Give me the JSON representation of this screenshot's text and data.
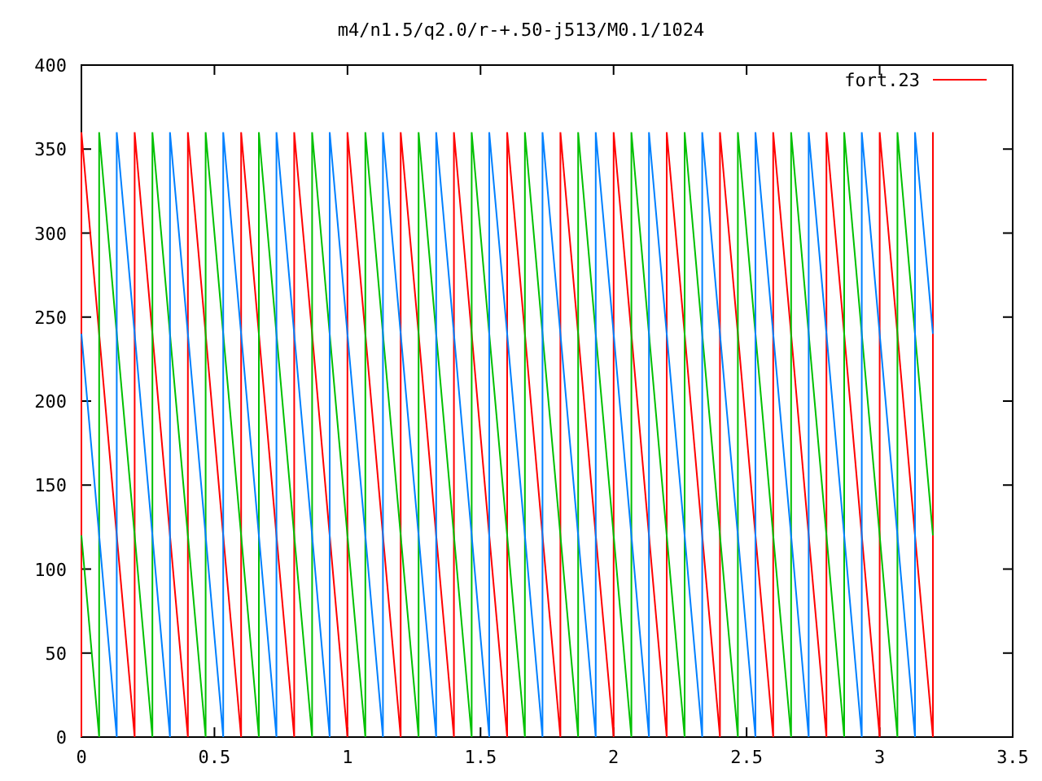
{
  "chart_data": {
    "type": "line",
    "title": "m4/n1.5/q2.0/r-+.50-j513/M0.1/1024",
    "x": [
      0,
      0,
      0.067,
      0.067,
      0.133,
      0.133,
      0.2,
      0.2,
      0.267,
      0.267,
      0.333,
      0.333,
      0.4,
      0.4,
      0.467,
      0.467,
      0.533,
      0.533,
      0.6,
      0.6,
      0.667,
      0.667,
      0.733,
      0.733,
      0.8,
      0.8,
      0.867,
      0.867,
      0.933,
      0.933,
      1,
      1,
      1.067,
      1.067,
      1.133,
      1.133,
      1.2,
      1.2,
      1.267,
      1.267,
      1.333,
      1.333,
      1.4,
      1.4,
      1.467,
      1.467,
      1.533,
      1.533,
      1.6,
      1.6,
      1.667,
      1.667,
      1.733,
      1.733,
      1.8,
      1.8,
      1.867,
      1.867,
      1.933,
      1.933,
      2,
      2,
      2.067,
      2.067,
      2.133,
      2.133,
      2.2,
      2.2,
      2.267,
      2.267,
      2.333,
      2.333,
      2.4,
      2.4,
      2.467,
      2.467,
      2.533,
      2.533,
      2.6,
      2.6,
      2.667,
      2.667,
      2.733,
      2.733,
      2.8,
      2.8,
      2.867,
      2.867,
      2.933,
      2.933,
      3,
      3,
      3.067,
      3.067,
      3.133,
      3.133,
      3.2,
      3.2
    ],
    "series": [
      {
        "name": "fort.23",
        "color": "#ff0000",
        "values": [
          0,
          360,
          240,
          240,
          120,
          120,
          0,
          360,
          240,
          240,
          120,
          120,
          0,
          360,
          240,
          240,
          120,
          120,
          0,
          360,
          240,
          240,
          120,
          120,
          0,
          360,
          240,
          240,
          120,
          120,
          0,
          360,
          240,
          240,
          120,
          120,
          0,
          360,
          240,
          240,
          120,
          120,
          0,
          360,
          240,
          240,
          120,
          120,
          0,
          360,
          240,
          240,
          120,
          120,
          0,
          360,
          240,
          240,
          120,
          120,
          0,
          360,
          240,
          240,
          120,
          120,
          0,
          360,
          240,
          240,
          120,
          120,
          0,
          360,
          240,
          240,
          120,
          120,
          0,
          360,
          240,
          240,
          120,
          120,
          0,
          360,
          240,
          240,
          120,
          120,
          0,
          360,
          240,
          240,
          120,
          120,
          0,
          360
        ]
      },
      {
        "color": "#00c000",
        "values": [
          120,
          120,
          0,
          360,
          240,
          240,
          120,
          120,
          0,
          360,
          240,
          240,
          120,
          120,
          0,
          360,
          240,
          240,
          120,
          120,
          0,
          360,
          240,
          240,
          120,
          120,
          0,
          360,
          240,
          240,
          120,
          120,
          0,
          360,
          240,
          240,
          120,
          120,
          0,
          360,
          240,
          240,
          120,
          120,
          0,
          360,
          240,
          240,
          120,
          120,
          0,
          360,
          240,
          240,
          120,
          120,
          0,
          360,
          240,
          240,
          120,
          120,
          0,
          360,
          240,
          240,
          120,
          120,
          0,
          360,
          240,
          240,
          120,
          120,
          0,
          360,
          240,
          240,
          120,
          120,
          0,
          360,
          240,
          240,
          120,
          120,
          0,
          360,
          240,
          240,
          120,
          120,
          0,
          360,
          240,
          240,
          120,
          120
        ]
      },
      {
        "color": "#0080ff",
        "values": [
          240,
          240,
          120,
          120,
          0,
          360,
          240,
          240,
          120,
          120,
          0,
          360,
          240,
          240,
          120,
          120,
          0,
          360,
          240,
          240,
          120,
          120,
          0,
          360,
          240,
          240,
          120,
          120,
          0,
          360,
          240,
          240,
          120,
          120,
          0,
          360,
          240,
          240,
          120,
          120,
          0,
          360,
          240,
          240,
          120,
          120,
          0,
          360,
          240,
          240,
          120,
          120,
          0,
          360,
          240,
          240,
          120,
          120,
          0,
          360,
          240,
          240,
          120,
          120,
          0,
          360,
          240,
          240,
          120,
          120,
          0,
          360,
          240,
          240,
          120,
          120,
          0,
          360,
          240,
          240,
          120,
          120,
          0,
          360,
          240,
          240,
          120,
          120,
          0,
          360,
          240,
          240,
          120,
          120,
          0,
          360,
          240,
          240
        ]
      }
    ],
    "xlim": [
      0,
      3.5
    ],
    "ylim": [
      0,
      400
    ],
    "xticks": [
      0,
      0.5,
      1,
      1.5,
      2,
      2.5,
      3,
      3.5
    ],
    "yticks": [
      0,
      50,
      100,
      150,
      200,
      250,
      300,
      350,
      400
    ]
  }
}
